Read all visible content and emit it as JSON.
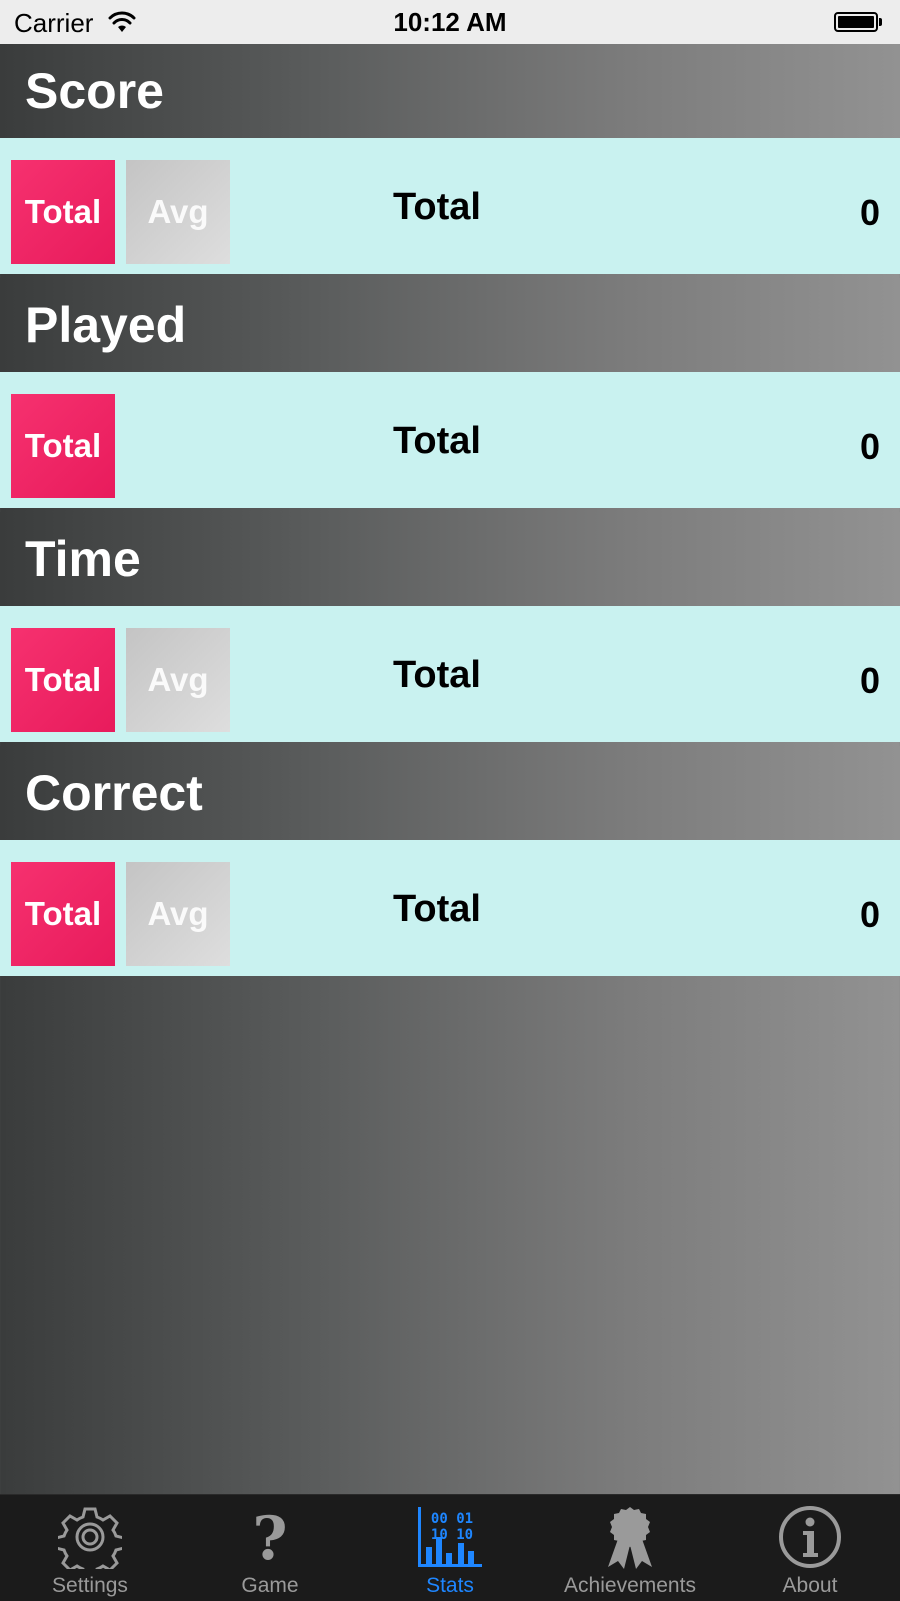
{
  "status_bar": {
    "carrier": "Carrier",
    "time": "10:12 AM"
  },
  "sections": [
    {
      "title": "Score",
      "buttons": {
        "total": "Total",
        "avg": "Avg"
      },
      "label": "Total",
      "value": "0"
    },
    {
      "title": "Played",
      "buttons": {
        "total": "Total"
      },
      "label": "Total",
      "value": "0"
    },
    {
      "title": "Time",
      "buttons": {
        "total": "Total",
        "avg": "Avg"
      },
      "label": "Total",
      "value": "0"
    },
    {
      "title": "Correct",
      "buttons": {
        "total": "Total",
        "avg": "Avg"
      },
      "label": "Total",
      "value": "0"
    }
  ],
  "tab_bar": {
    "items": [
      {
        "label": "Settings",
        "icon": "gear-icon"
      },
      {
        "label": "Game",
        "icon": "question-mark-icon"
      },
      {
        "label": "Stats",
        "icon": "stats-chart-icon",
        "icon_text_top": "00 01",
        "icon_text_bottom": "10 10"
      },
      {
        "label": "Achievements",
        "icon": "ribbon-badge-icon"
      },
      {
        "label": "About",
        "icon": "info-icon"
      }
    ],
    "active_index": 2,
    "active_color": "#1e86ff",
    "inactive_color": "#9a9a9a"
  },
  "colors": {
    "total_button": "#f6316f",
    "avg_button": "#c4c4c4",
    "row_background": "#c9f2f0"
  }
}
